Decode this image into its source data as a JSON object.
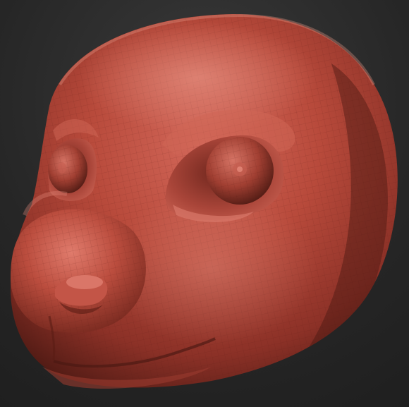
{
  "scene": {
    "subject": "clay-sculpt-animal-head",
    "material_color": "#b84a3b",
    "highlight_color": "#f0a090",
    "shadow_color": "#4a1812",
    "background_color": "#2a2a2a",
    "wireframe_visible": true
  }
}
